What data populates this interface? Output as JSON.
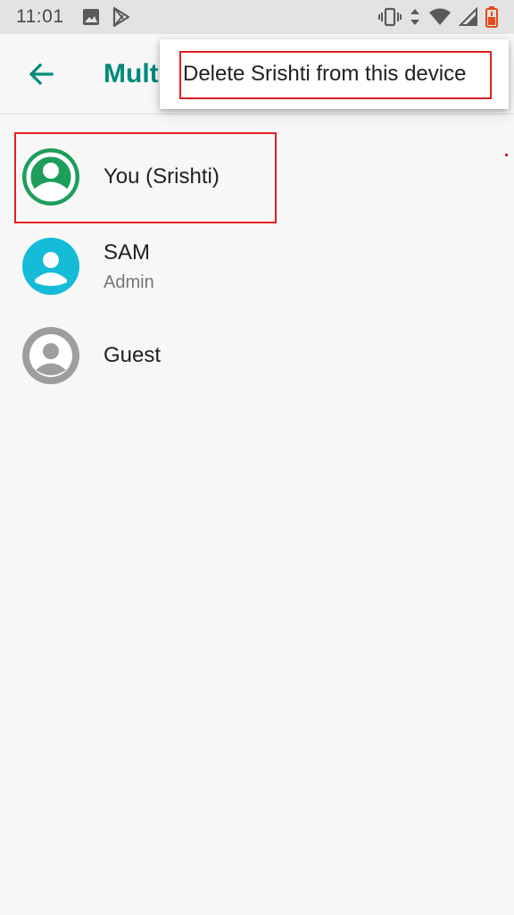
{
  "status_bar": {
    "time": "11:01",
    "left_icons": [
      "image-icon",
      "play-store-icon"
    ],
    "right_icons": [
      "vibrate-icon",
      "data-arrows-icon",
      "wifi-icon",
      "signal-icon",
      "battery-low-icon"
    ],
    "battery_color": "#e64a19"
  },
  "app_bar": {
    "title": "Multiple users",
    "accent_color": "#00897b"
  },
  "overflow_menu": {
    "items": [
      {
        "label": "Delete Srishti from this device"
      }
    ]
  },
  "users": [
    {
      "name": "You (Srishti)",
      "subtitle": "",
      "avatar_color": "#1e9e5a"
    },
    {
      "name": "SAM",
      "subtitle": "Admin",
      "avatar_color": "#14bcd8"
    },
    {
      "name": "Guest",
      "subtitle": "",
      "avatar_color": "#9e9e9e"
    }
  ]
}
